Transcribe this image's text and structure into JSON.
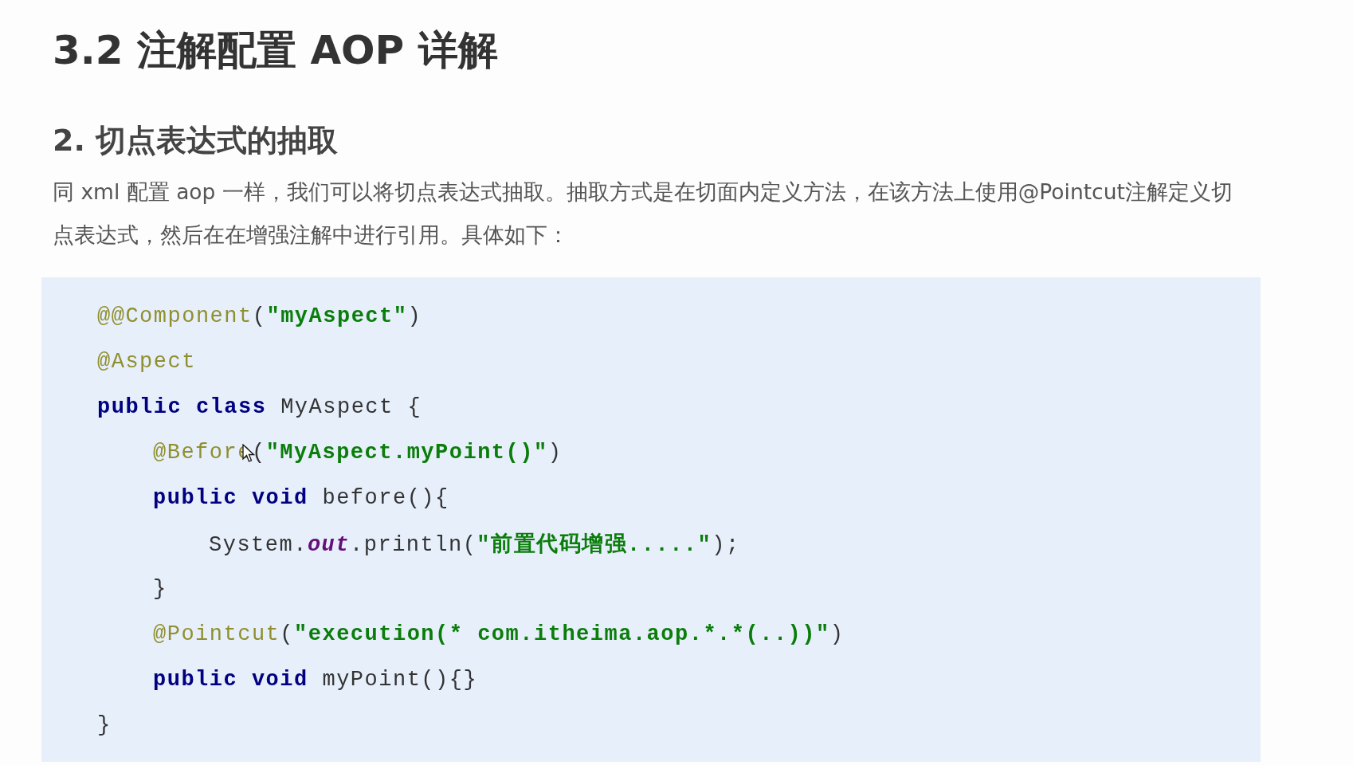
{
  "heading": "3.2 注解配置 AOP 详解",
  "subheading": "2. 切点表达式的抽取",
  "paragraph": "同 xml 配置 aop 一样，我们可以将切点表达式抽取。抽取方式是在切面内定义方法，在该方法上使用@Pointcut注解定义切点表达式，然后在在增强注解中进行引用。具体如下：",
  "code": [
    {
      "tokens": [
        {
          "kind": "annotation",
          "text": "@@Component"
        },
        {
          "kind": "plain",
          "text": "("
        },
        {
          "kind": "string",
          "text": "\"myAspect\""
        },
        {
          "kind": "plain",
          "text": ")"
        }
      ]
    },
    {
      "tokens": [
        {
          "kind": "annotation",
          "text": "@Aspect"
        }
      ]
    },
    {
      "tokens": [
        {
          "kind": "keyword",
          "text": "public class"
        },
        {
          "kind": "plain",
          "text": " MyAspect {"
        }
      ],
      "children": [
        {
          "cursor": true,
          "tokens": [
            {
              "kind": "annotation",
              "text": "@Before"
            },
            {
              "kind": "plain",
              "text": "("
            },
            {
              "kind": "string",
              "text": "\"MyAspect.myPoint()\""
            },
            {
              "kind": "plain",
              "text": ")"
            }
          ]
        },
        {
          "tokens": [
            {
              "kind": "keyword",
              "text": "public void"
            },
            {
              "kind": "plain",
              "text": " before(){"
            }
          ],
          "children": [
            {
              "tokens": [
                {
                  "kind": "plain",
                  "text": "System."
                },
                {
                  "kind": "field",
                  "text": "out"
                },
                {
                  "kind": "plain",
                  "text": ".println("
                },
                {
                  "kind": "string",
                  "text": "\"前置代码增强.....\""
                },
                {
                  "kind": "plain",
                  "text": ");"
                }
              ]
            }
          ]
        },
        {
          "tokens": [
            {
              "kind": "plain",
              "text": "}"
            }
          ]
        },
        {
          "tokens": [
            {
              "kind": "annotation",
              "text": "@Pointcut"
            },
            {
              "kind": "plain",
              "text": "("
            },
            {
              "kind": "string",
              "text": "\"execution(* com.itheima.aop.*.*(..))\""
            },
            {
              "kind": "plain",
              "text": ")"
            }
          ]
        },
        {
          "tokens": [
            {
              "kind": "keyword",
              "text": "public void"
            },
            {
              "kind": "plain",
              "text": " myPoint(){}"
            }
          ]
        }
      ]
    },
    {
      "tokens": [
        {
          "kind": "plain",
          "text": "}"
        }
      ]
    }
  ]
}
